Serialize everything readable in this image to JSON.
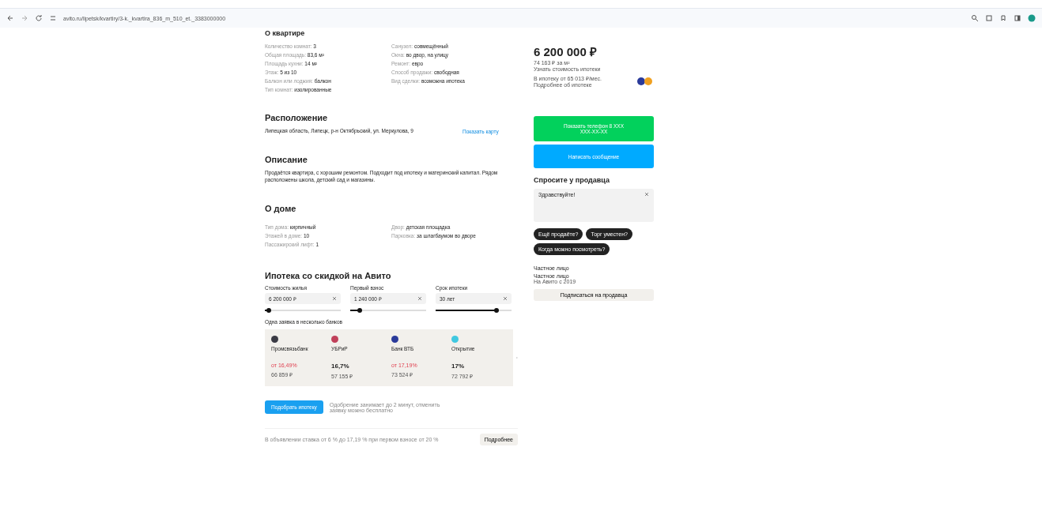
{
  "browser": {
    "url": "avito.ru/lipetsk/kvartiry/3-k._kvartira_836_m_510_et._3383000000"
  },
  "about_apartment": {
    "title": "О квартире",
    "left": [
      {
        "label": "Количество комнат:",
        "value": "3"
      },
      {
        "label": "Общая площадь:",
        "value": "83,6 м²"
      },
      {
        "label": "Площадь кухни:",
        "value": "14 м²"
      },
      {
        "label": "Этаж:",
        "value": "5 из 10"
      },
      {
        "label": "Балкон или лоджия:",
        "value": "балкон"
      },
      {
        "label": "Тип комнат:",
        "value": "изолированные"
      }
    ],
    "right": [
      {
        "label": "Санузел:",
        "value": "совмещённый"
      },
      {
        "label": "Окна:",
        "value": "во двор, на улицу"
      },
      {
        "label": "Ремонт:",
        "value": "евро"
      },
      {
        "label": "Способ продажи:",
        "value": "свободная"
      },
      {
        "label": "Вид сделки:",
        "value": "возможна ипотека"
      }
    ]
  },
  "location": {
    "title": "Расположение",
    "address": "Липецкая область, Липецк, р-н Октябрьский, ул. Меркулова, 9",
    "map_link": "Показать карту"
  },
  "description": {
    "title": "Описание",
    "text": "Продаётся квартира, с хорошим ремонтом. Подходит под ипотеку и материнский капитал. Рядом расположены школа, детский сад и магазины."
  },
  "about_house": {
    "title": "О доме",
    "left": [
      {
        "label": "Тип дома:",
        "value": "кирпичный"
      },
      {
        "label": "Этажей в доме:",
        "value": "10"
      },
      {
        "label": "Пассажирский лифт:",
        "value": "1"
      }
    ],
    "right": [
      {
        "label": "Двор:",
        "value": "детская площадка"
      },
      {
        "label": "Парковка:",
        "value": "за шлагбаумом во дворе"
      }
    ]
  },
  "mortgage": {
    "title": "Ипотека со скидкой на Авито",
    "fields": [
      {
        "label": "Стоимость жилья",
        "value": "6 200 000 ₽",
        "level": 0.05
      },
      {
        "label": "Первый взнос",
        "value": "1 240 000 ₽",
        "level": 0.12
      },
      {
        "label": "Срок ипотеки",
        "value": "30 лет",
        "level": 0.8
      }
    ],
    "banks_title": "Одна заявка в несколько банков",
    "banks": [
      {
        "name": "Промсвязьбанк",
        "color": "#3a3a44",
        "rate": "от 16,49%",
        "discounted": true,
        "payment": "66 859 ₽"
      },
      {
        "name": "УБРиР",
        "color": "#c0405a",
        "rate": "16,7%",
        "discounted": false,
        "payment": "57 155 ₽"
      },
      {
        "name": "Банк ВТБ",
        "color": "#2a3a9a",
        "rate": "от 17,19%",
        "discounted": true,
        "payment": "73 524 ₽"
      },
      {
        "name": "Открытие",
        "color": "#40c8e0",
        "rate": "17%",
        "discounted": false,
        "payment": "72 792 ₽"
      }
    ],
    "apply_button": "Подобрать ипотеку",
    "apply_note": "Одобрение занимает до 2 минут, отменить заявку можно бесплатно",
    "footer_text": "В объявлении ставка от 6 % до 17,19 % при первом взносе от 20 %",
    "footer_button": "Подробнее"
  },
  "sidebar": {
    "price": "6 200 000 ₽",
    "price_per_m2": "74 163 ₽ за м²",
    "price_link": "Узнать стоимость ипотеки",
    "mortgage_line": "В ипотеку от 65 013 ₽/мес.",
    "mortgage_link": "Подробнее об ипотеке",
    "phone_button": "Показать телефон 8 XXX XXX-XX-XX",
    "message_button": "Написать сообщение",
    "ask_title": "Спросите у продавца",
    "ask_value": "Здравствуйте!",
    "chips": [
      "Ещё продаёте?",
      "Торг уместен?",
      "Когда можно посмотреть?"
    ],
    "seller_lines": [
      "Частное лицо",
      "Частное лицо"
    ],
    "seller_link": "На Авито с 2019",
    "subscribe_button": "Подписаться на продавца"
  }
}
